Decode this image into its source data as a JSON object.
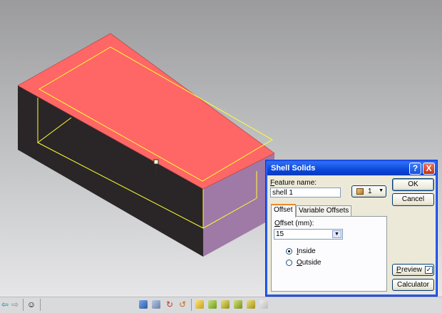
{
  "dialog": {
    "title": "Shell Solids",
    "help_button": "?",
    "close_button": "X",
    "feature_name_label": "Feature name:",
    "feature_name_value": "shell 1",
    "instance_value": "1",
    "ok_label": "OK",
    "cancel_label": "Cancel",
    "tabs": [
      {
        "label": "Offset",
        "active": true
      },
      {
        "label": "Variable Offsets",
        "active": false
      }
    ],
    "offset_label": "Offset (mm):",
    "offset_value": "15",
    "inside_label": "Inside",
    "outside_label": "Outside",
    "selected_direction": "Inside",
    "preview_label": "Preview",
    "preview_checked": true,
    "calculator_label": "Calculator"
  },
  "colors": {
    "top_face": "#ff6666",
    "side_face": "#2a2628",
    "end_face": "#a07aa6",
    "edge_highlight": "#ffff33",
    "title_bar": "#0a47d8"
  },
  "toolbar": {
    "icons": [
      "left-arrow-icon",
      "right-arrow-icon",
      "smiley-icon",
      "view-cube-icon",
      "shaded-icon",
      "rotate-icon",
      "curve-icon",
      "feature-icon",
      "solid-icon",
      "solid-edges-icon",
      "wireframe-icon",
      "hidden-icon",
      "page-icon"
    ]
  }
}
